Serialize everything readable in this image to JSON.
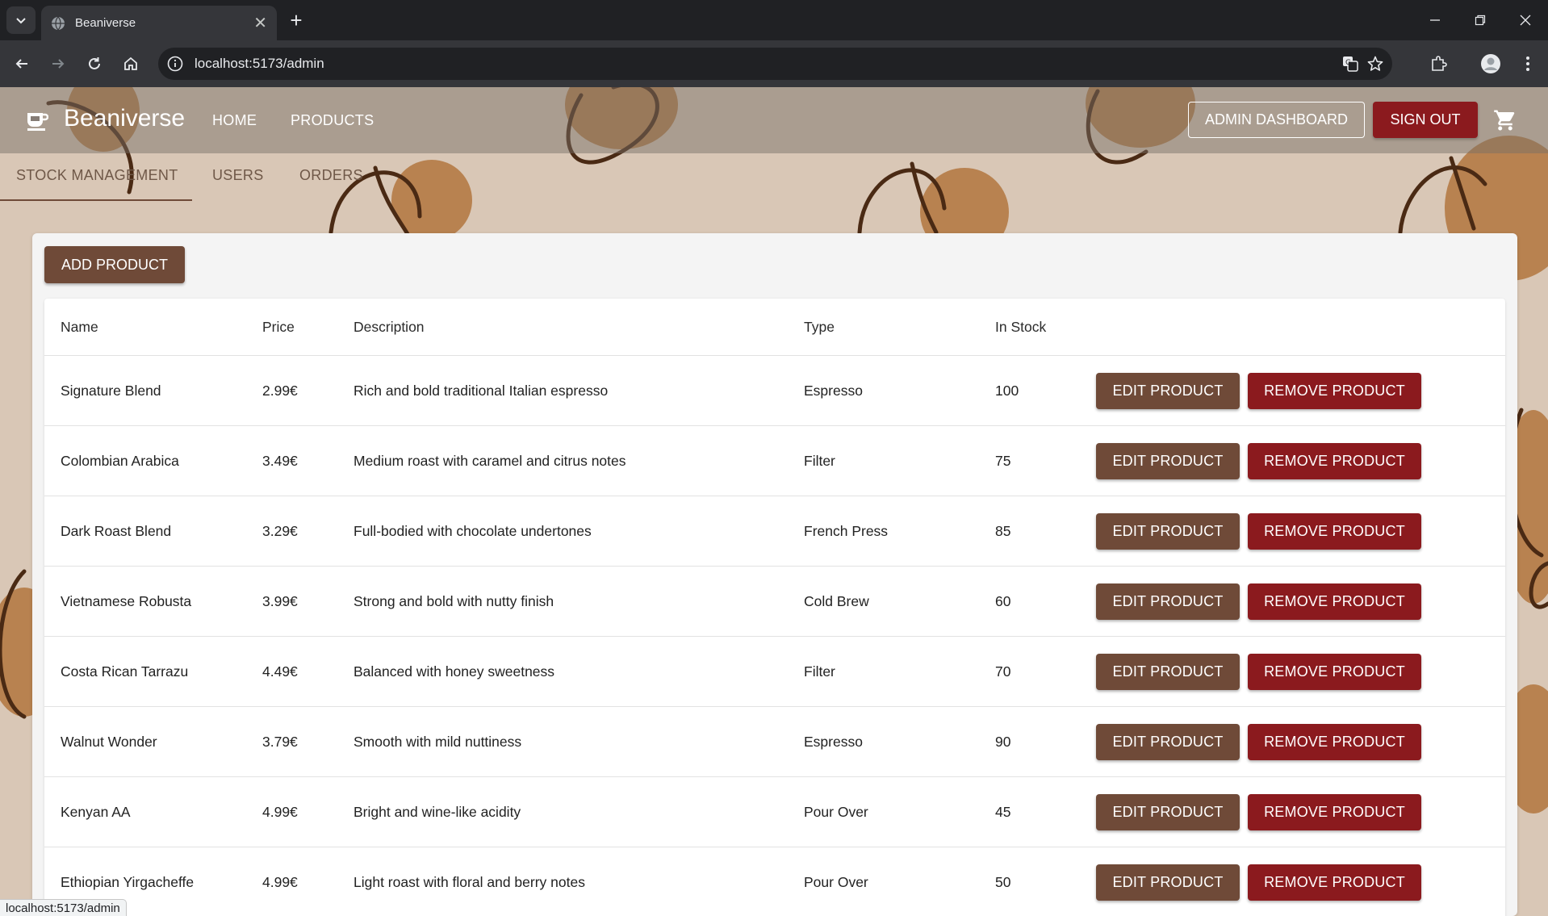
{
  "browser": {
    "tab_title": "Beaniverse",
    "url": "localhost:5173/admin",
    "status_url": "localhost:5173/admin"
  },
  "app": {
    "brand": "Beaniverse",
    "nav": {
      "home": "HOME",
      "products": "PRODUCTS"
    },
    "admin_dashboard": "ADMIN DASHBOARD",
    "sign_out": "SIGN OUT"
  },
  "admin_tabs": [
    "STOCK MANAGEMENT",
    "USERS",
    "ORDERS"
  ],
  "add_product": "ADD PRODUCT",
  "table": {
    "headers": [
      "Name",
      "Price",
      "Description",
      "Type",
      "In Stock"
    ],
    "edit_label": "EDIT PRODUCT",
    "remove_label": "REMOVE PRODUCT",
    "rows": [
      [
        "Signature Blend",
        "2.99€",
        "Rich and bold traditional Italian espresso",
        "Espresso",
        "100"
      ],
      [
        "Colombian Arabica",
        "3.49€",
        "Medium roast with caramel and citrus notes",
        "Filter",
        "75"
      ],
      [
        "Dark Roast Blend",
        "3.29€",
        "Full-bodied with chocolate undertones",
        "French Press",
        "85"
      ],
      [
        "Vietnamese Robusta",
        "3.99€",
        "Strong and bold with nutty finish",
        "Cold Brew",
        "60"
      ],
      [
        "Costa Rican Tarrazu",
        "4.49€",
        "Balanced with honey sweetness",
        "Filter",
        "70"
      ],
      [
        "Walnut Wonder",
        "3.79€",
        "Smooth with mild nuttiness",
        "Espresso",
        "90"
      ],
      [
        "Kenyan AA",
        "4.99€",
        "Bright and wine-like acidity",
        "Pour Over",
        "45"
      ],
      [
        "Ethiopian Yirgacheffe",
        "4.99€",
        "Light roast with floral and berry notes",
        "Pour Over",
        "50"
      ]
    ]
  },
  "colors": {
    "primary_brown": "#6f4a38",
    "danger_red": "#8b1a1e",
    "background": "#d9c7b6"
  },
  "icons": [
    "tab-search-icon",
    "globe-icon",
    "close-icon",
    "plus-icon",
    "minimize-icon",
    "restore-icon",
    "window-close-icon",
    "back-icon",
    "forward-icon",
    "reload-icon",
    "home-icon",
    "info-icon",
    "translate-icon",
    "star-icon",
    "extensions-icon",
    "profile-icon",
    "more-icon",
    "coffee-cup-icon",
    "cart-icon"
  ]
}
